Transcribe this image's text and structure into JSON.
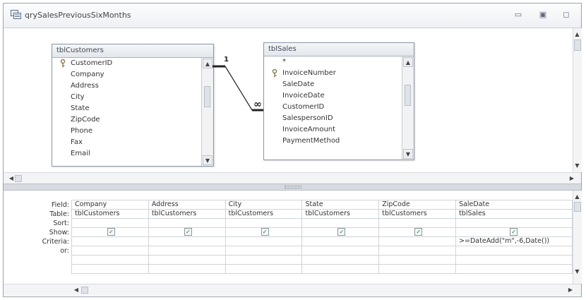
{
  "window": {
    "title": "qrySalesPreviousSixMonths"
  },
  "tables": {
    "customers": {
      "name": "tblCustomers",
      "fields": [
        "CustomerID",
        "Company",
        "Address",
        "City",
        "State",
        "ZipCode",
        "Phone",
        "Fax",
        "Email"
      ]
    },
    "sales": {
      "name": "tblSales",
      "fields": [
        "*",
        "InvoiceNumber",
        "SaleDate",
        "InvoiceDate",
        "CustomerID",
        "SalespersonID",
        "InvoiceAmount",
        "PaymentMethod"
      ]
    }
  },
  "relationship": {
    "one_label": "1",
    "many_label": "∞"
  },
  "grid": {
    "row_labels": [
      "Field:",
      "Table:",
      "Sort:",
      "Show:",
      "Criteria:",
      "or:"
    ],
    "columns": [
      {
        "field": "Company",
        "table": "tblCustomers",
        "sort": "",
        "show": true,
        "criteria": ""
      },
      {
        "field": "Address",
        "table": "tblCustomers",
        "sort": "",
        "show": true,
        "criteria": ""
      },
      {
        "field": "City",
        "table": "tblCustomers",
        "sort": "",
        "show": true,
        "criteria": ""
      },
      {
        "field": "State",
        "table": "tblCustomers",
        "sort": "",
        "show": true,
        "criteria": ""
      },
      {
        "field": "ZipCode",
        "table": "tblCustomers",
        "sort": "",
        "show": true,
        "criteria": ""
      },
      {
        "field": "SaleDate",
        "table": "tblSales",
        "sort": "",
        "show": true,
        "criteria": ">=DateAdd(\"m\",-6,Date())"
      }
    ]
  },
  "icons": {
    "query": "query-icon",
    "key": "primary-key-icon",
    "minimize": "minimize-icon",
    "restore": "restore-icon",
    "close": "close-icon",
    "check": "✓"
  }
}
